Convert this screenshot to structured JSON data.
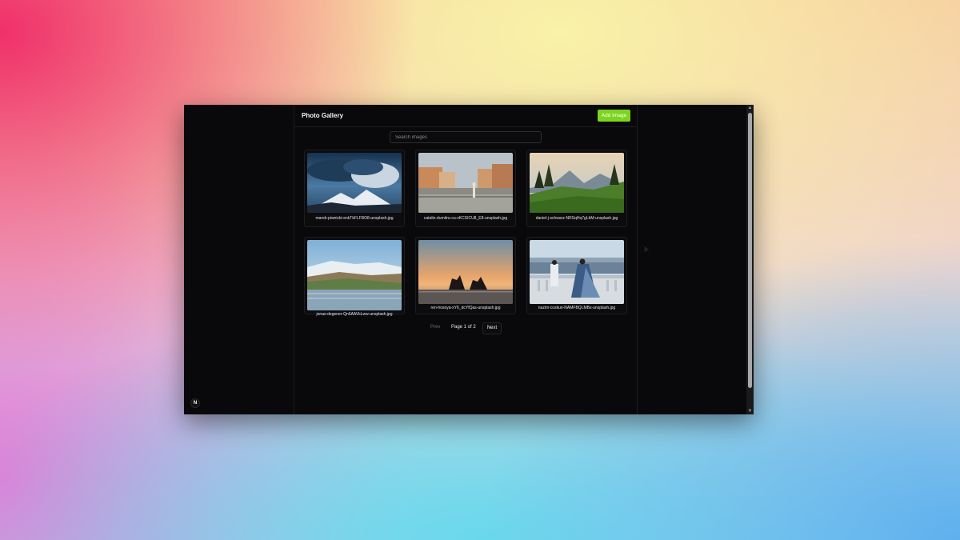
{
  "app": {
    "title": "Photo Gallery",
    "add_button_label": "Add Image"
  },
  "search": {
    "placeholder": "Search images",
    "value": ""
  },
  "gallery": {
    "items": [
      {
        "filename": "marek-piwnicki-enkTkFLFBO8-unsplash.jpg"
      },
      {
        "filename": "catalin-dumitru-cu-xKCSICU8_E8-unsplash.jpg"
      },
      {
        "filename": "daniel-j-schwarz-NRSqHq7gLbM-unsplash.jpg"
      },
      {
        "filename": "jonas-degener-Qn6AAVkLww-unsplash.jpg"
      },
      {
        "filename": "ren-hosoya-xY6_dcYfQas-unsplash.jpg"
      },
      {
        "filename": "nazim-coskun-NAMFBQLMBs-unsplash.jpg"
      }
    ]
  },
  "pagination": {
    "prev_label": "Prev",
    "page_label": "Page 1 of 2",
    "next_label": "Next"
  },
  "badge": {
    "label": "N"
  },
  "colors": {
    "accent": "#7bd51d",
    "background": "#09090b"
  }
}
